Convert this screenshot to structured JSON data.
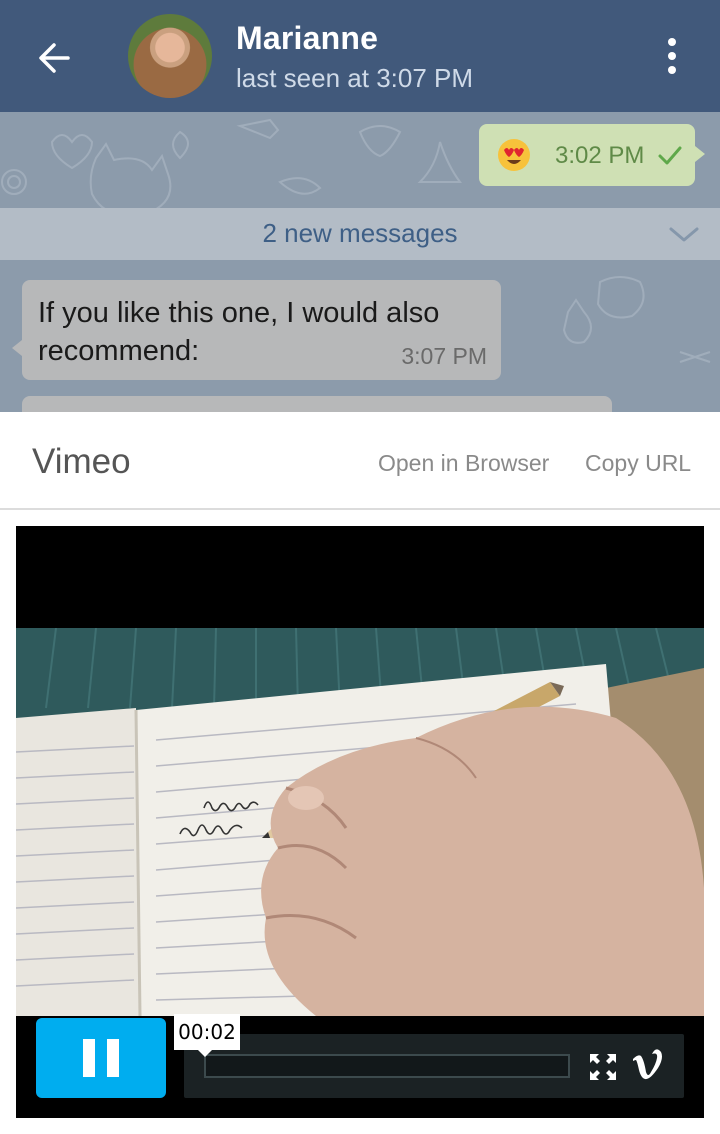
{
  "header": {
    "contact_name": "Marianne",
    "status": "last seen at 3:07 PM",
    "back_icon": "arrow-left-icon",
    "menu_icon": "more-vertical-icon",
    "color": "#41597b"
  },
  "chat": {
    "outgoing": {
      "emoji": "heart-eyes-emoji",
      "time": "3:02 PM",
      "status_icon": "check-icon"
    },
    "new_messages_label": "2 new messages",
    "incoming": {
      "text": "If you like this one, I would also recommend:",
      "time": "3:07 PM"
    }
  },
  "embed": {
    "title": "Vimeo",
    "open_in_browser_label": "Open in Browser",
    "copy_url_label": "Copy URL",
    "player": {
      "current_time": "00:02",
      "progress": 0,
      "play_state_icon": "pause-icon",
      "fullscreen_icon": "fullscreen-icon",
      "logo": "vimeo-logo",
      "accent": "#00adef"
    }
  }
}
